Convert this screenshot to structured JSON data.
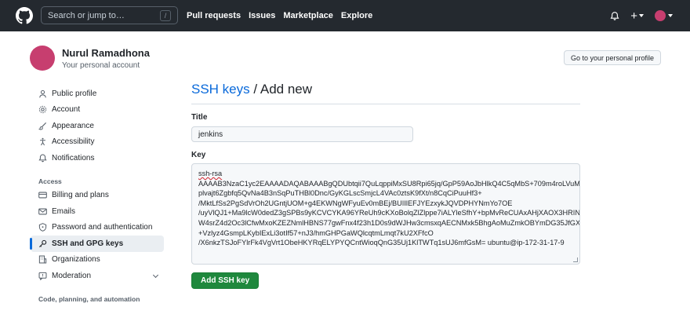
{
  "header": {
    "search_placeholder": "Search or jump to…",
    "search_shortcut": "/",
    "nav": [
      "Pull requests",
      "Issues",
      "Marketplace",
      "Explore"
    ],
    "plus_label": "+"
  },
  "profile": {
    "name": "Nurul Ramadhona",
    "subtitle": "Your personal account",
    "go_to_profile_label": "Go to your personal profile"
  },
  "sidebar": {
    "items": [
      {
        "label": "Public profile",
        "icon": "person-icon"
      },
      {
        "label": "Account",
        "icon": "gear-icon"
      },
      {
        "label": "Appearance",
        "icon": "paintbrush-icon"
      },
      {
        "label": "Accessibility",
        "icon": "accessibility-icon"
      },
      {
        "label": "Notifications",
        "icon": "bell-icon"
      }
    ],
    "access_heading": "Access",
    "access_items": [
      {
        "label": "Billing and plans",
        "icon": "credit-card-icon"
      },
      {
        "label": "Emails",
        "icon": "mail-icon"
      },
      {
        "label": "Password and authentication",
        "icon": "shield-lock-icon"
      },
      {
        "label": "SSH and GPG keys",
        "icon": "key-icon",
        "active": true
      },
      {
        "label": "Organizations",
        "icon": "organization-icon"
      },
      {
        "label": "Moderation",
        "icon": "report-icon"
      }
    ],
    "code_heading": "Code, planning, and automation"
  },
  "main": {
    "title_link": "SSH keys",
    "title_sep": " / ",
    "title_rest": "Add new",
    "title_label": "Title",
    "title_value": "jenkins",
    "key_label": "Key",
    "key_prefix": "ssh-rsa",
    "key_lines": [
      "AAAAB3NzaC1yc2EAAAADAQABAAABgQDUbtqii7QuLqppiMxSU8Rpi65jq/GpP59AoJbHlkQ4C5qMbS+709m4roLVuM",
      "plvajt6Zgbfq5QvNa4B3nSqPuTHBl0Dnc/GyKGLscSmjcL4VAc0ztsK9fXt/n8CqCiPuuHf3+",
      "/MktLfSs2PgSdVrOh2UGntjUOM+g4EKWNgWFyuEv0mBEj/BUIIlEFJYEzxykJQVDPHYNmYo7OE",
      "/uyVlQJ1+Ma9lcW0dedZ3gSPBs9yKCVCYKA96YReUh9cKXoBolqZlZlppe7iALYleSfhY+bpMvReCUAxAHjXAOX3HRIN",
      "W4srZ4d2Oc3lCfwMxoKZEZNmlHBNS77gwFnx4f23h1D0s9dWJHw3cmsxqAECNMxk5BhgAoMuZmkOBYmDG35JfGX",
      "+Vzlyz4GsmpLKybIExLi3otIf57+nJ3/hmGHPGaWQlcqtmLmqt7kU2XFfcO",
      "/X6nkzTSJoFYlrFk4VgVrt1ObeHKYRqELYPYQCntWioqQnG35Uj1KlTWTq1sUJ6mfGsM= ubuntu@ip-172-31-17-9"
    ],
    "submit_label": "Add SSH key"
  }
}
